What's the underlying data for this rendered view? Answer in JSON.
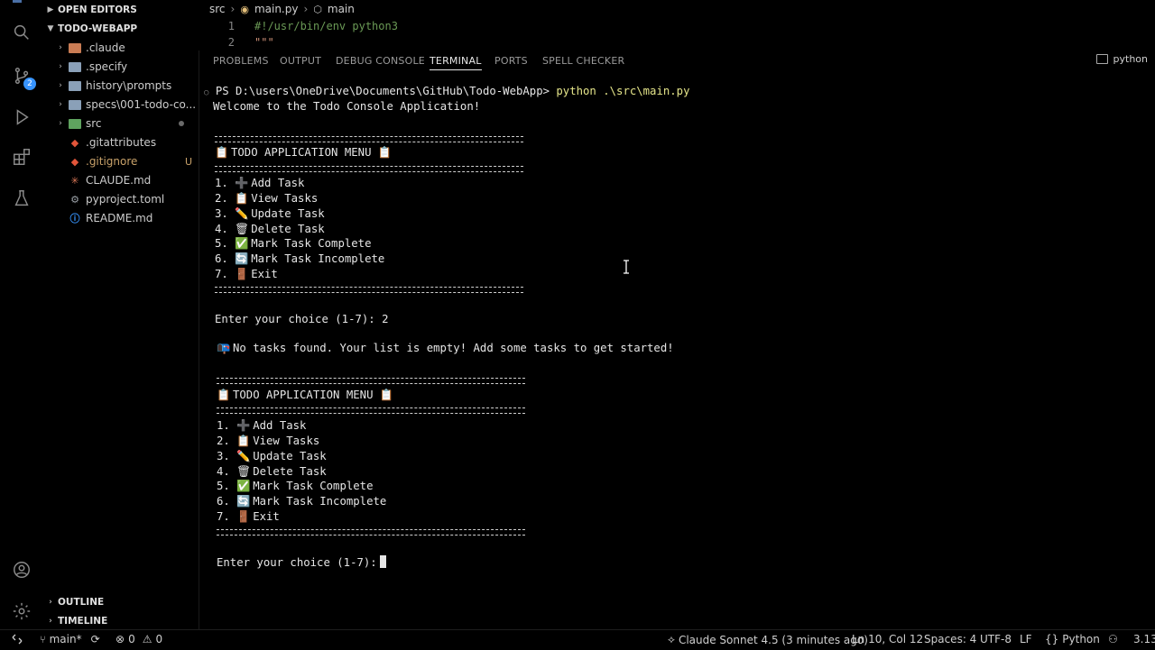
{
  "sidebar": {
    "open_editors": "OPEN EDITORS",
    "project": "TODO-WEBAPP",
    "items": [
      {
        "label": ".claude",
        "kind": "folder",
        "color": "#c97c54"
      },
      {
        "label": ".specify",
        "kind": "folder",
        "color": "#8aa0b8"
      },
      {
        "label": "history\\prompts",
        "kind": "folder",
        "color": "#8aa0b8"
      },
      {
        "label": "specs\\001-todo-co...",
        "kind": "folder",
        "color": "#8aa0b8"
      },
      {
        "label": "src",
        "kind": "folder",
        "color": "#5fa35f"
      },
      {
        "label": ".gitattributes",
        "kind": "file",
        "icon": "git-icon",
        "color": "#e2553a"
      },
      {
        "label": ".gitignore",
        "kind": "file",
        "icon": "git-icon",
        "color": "#e2553a",
        "status": "U"
      },
      {
        "label": "CLAUDE.md",
        "kind": "file",
        "icon": "claude-icon",
        "color": "#d97757"
      },
      {
        "label": "pyproject.toml",
        "kind": "file",
        "icon": "gear-icon",
        "color": "#9aa0a6"
      },
      {
        "label": "README.md",
        "kind": "file",
        "icon": "info-icon",
        "color": "#3794ff"
      }
    ],
    "outline": "OUTLINE",
    "timeline": "TIMELINE"
  },
  "editor": {
    "breadcrumbs": [
      "src",
      "main.py",
      "main"
    ],
    "lines": [
      {
        "num": "1",
        "text": "#!/usr/bin/env python3"
      },
      {
        "num": "2",
        "text": "\"\"\""
      }
    ]
  },
  "panel": {
    "tabs": [
      "PROBLEMS",
      "OUTPUT",
      "DEBUG CONSOLE",
      "TERMINAL",
      "PORTS",
      "SPELL CHECKER"
    ],
    "active_tab": "TERMINAL",
    "terminal_name": "python"
  },
  "terminal": {
    "prompt_path": "PS D:\\users\\OneDrive\\Documents\\GitHub\\Todo-WebApp>",
    "command": "python .\\src\\main.py",
    "welcome": "Welcome to the Todo Console Application!",
    "menu_title": "TODO APPLICATION MENU",
    "menu_items": [
      {
        "num": "1.",
        "icon": "➕",
        "label": "Add Task"
      },
      {
        "num": "2.",
        "icon": "📋",
        "label": "View Tasks"
      },
      {
        "num": "3.",
        "icon": "✏️",
        "label": "Update Task"
      },
      {
        "num": "4.",
        "icon": "🗑",
        "label": "Delete Task"
      },
      {
        "num": "5.",
        "icon": "✅",
        "label": "Mark Task Complete"
      },
      {
        "num": "6.",
        "icon": "🔄",
        "label": "Mark Task Incomplete"
      },
      {
        "num": "7.",
        "icon": "🚪",
        "label": "Exit"
      }
    ],
    "choice_prompt": "Enter your choice (1-7): ",
    "choice_value": "2",
    "empty_msg": "No tasks found. Your list is empty! Add some tasks to get started!",
    "final_prompt": "Enter your choice (1-7):"
  },
  "status": {
    "branch": "main*",
    "errors": "0",
    "warnings": "0",
    "model": "Claude Sonnet 4.5 (3 minutes ago)",
    "position": "Ln 10, Col 12",
    "spaces": "Spaces: 4",
    "encoding": "UTF-8",
    "eol": "LF",
    "language": "Python",
    "version": "3.13"
  },
  "colors": {
    "accent": "#3794ff",
    "background": "#000000",
    "text": "#e6e6e6"
  }
}
